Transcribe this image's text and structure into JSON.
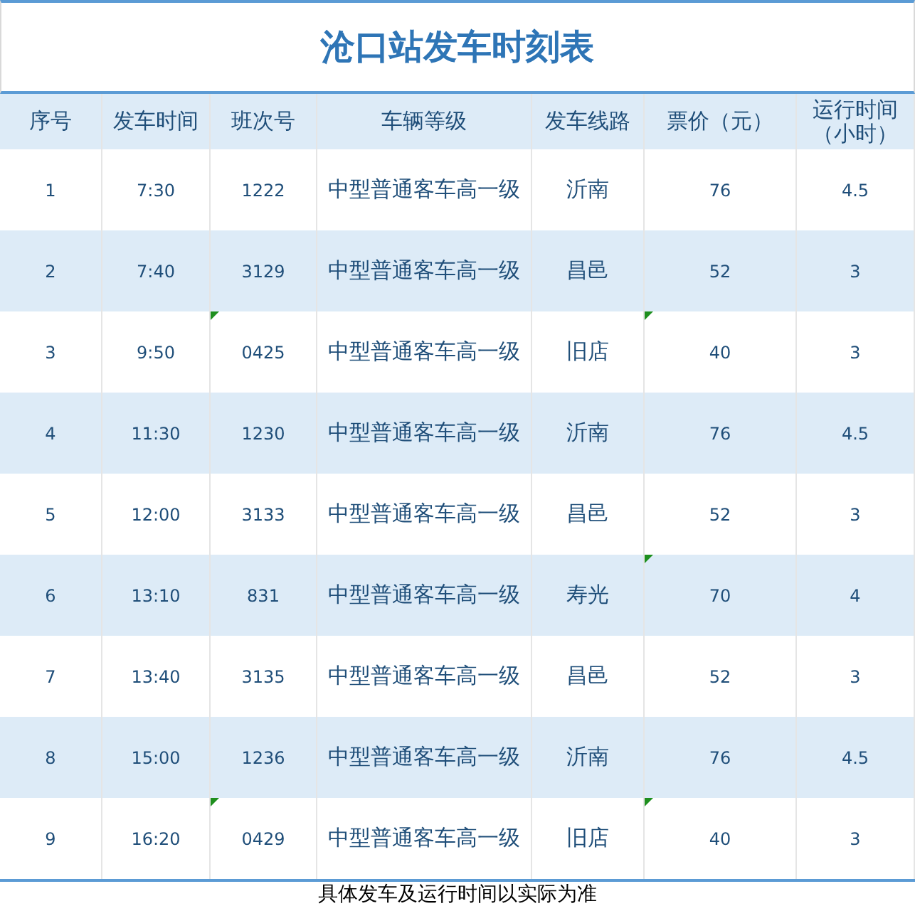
{
  "title": "沧口站发车时刻表",
  "columns": [
    "序号",
    "发车时间",
    "班次号",
    "车辆等级",
    "发车线路",
    "票价（元）",
    "运行时间（小时）"
  ],
  "rows": [
    {
      "cells": [
        {
          "text": "1",
          "flagged": false
        },
        {
          "text": "7:30",
          "flagged": false
        },
        {
          "text": "1222",
          "flagged": false
        },
        {
          "text": "中型普通客车高一级",
          "flagged": false
        },
        {
          "text": "沂南",
          "flagged": false
        },
        {
          "text": "76",
          "flagged": false
        },
        {
          "text": "4.5",
          "flagged": false
        }
      ]
    },
    {
      "cells": [
        {
          "text": "2",
          "flagged": false
        },
        {
          "text": "7:40",
          "flagged": false
        },
        {
          "text": "3129",
          "flagged": false
        },
        {
          "text": "中型普通客车高一级",
          "flagged": false
        },
        {
          "text": "昌邑",
          "flagged": false
        },
        {
          "text": "52",
          "flagged": false
        },
        {
          "text": "3",
          "flagged": false
        }
      ]
    },
    {
      "cells": [
        {
          "text": "3",
          "flagged": false
        },
        {
          "text": "9:50",
          "flagged": false
        },
        {
          "text": "0425",
          "flagged": true
        },
        {
          "text": "中型普通客车高一级",
          "flagged": false
        },
        {
          "text": "旧店",
          "flagged": false
        },
        {
          "text": "40",
          "flagged": true
        },
        {
          "text": "3",
          "flagged": false
        }
      ]
    },
    {
      "cells": [
        {
          "text": "4",
          "flagged": false
        },
        {
          "text": "11:30",
          "flagged": false
        },
        {
          "text": "1230",
          "flagged": false
        },
        {
          "text": "中型普通客车高一级",
          "flagged": false
        },
        {
          "text": "沂南",
          "flagged": false
        },
        {
          "text": "76",
          "flagged": false
        },
        {
          "text": "4.5",
          "flagged": false
        }
      ]
    },
    {
      "cells": [
        {
          "text": "5",
          "flagged": false
        },
        {
          "text": "12:00",
          "flagged": false
        },
        {
          "text": "3133",
          "flagged": false
        },
        {
          "text": "中型普通客车高一级",
          "flagged": false
        },
        {
          "text": "昌邑",
          "flagged": false
        },
        {
          "text": "52",
          "flagged": false
        },
        {
          "text": "3",
          "flagged": false
        }
      ]
    },
    {
      "cells": [
        {
          "text": "6",
          "flagged": false
        },
        {
          "text": "13:10",
          "flagged": false
        },
        {
          "text": "831",
          "flagged": false
        },
        {
          "text": "中型普通客车高一级",
          "flagged": false
        },
        {
          "text": "寿光",
          "flagged": false
        },
        {
          "text": "70",
          "flagged": true
        },
        {
          "text": "4",
          "flagged": false
        }
      ]
    },
    {
      "cells": [
        {
          "text": "7",
          "flagged": false
        },
        {
          "text": "13:40",
          "flagged": false
        },
        {
          "text": "3135",
          "flagged": false
        },
        {
          "text": "中型普通客车高一级",
          "flagged": false
        },
        {
          "text": "昌邑",
          "flagged": false
        },
        {
          "text": "52",
          "flagged": false
        },
        {
          "text": "3",
          "flagged": false
        }
      ]
    },
    {
      "cells": [
        {
          "text": "8",
          "flagged": false
        },
        {
          "text": "15:00",
          "flagged": false
        },
        {
          "text": "1236",
          "flagged": false
        },
        {
          "text": "中型普通客车高一级",
          "flagged": false
        },
        {
          "text": "沂南",
          "flagged": false
        },
        {
          "text": "76",
          "flagged": false
        },
        {
          "text": "4.5",
          "flagged": false
        }
      ]
    },
    {
      "cells": [
        {
          "text": "9",
          "flagged": false
        },
        {
          "text": "16:20",
          "flagged": false
        },
        {
          "text": "0429",
          "flagged": true
        },
        {
          "text": "中型普通客车高一级",
          "flagged": false
        },
        {
          "text": "旧店",
          "flagged": false
        },
        {
          "text": "40",
          "flagged": true
        },
        {
          "text": "3",
          "flagged": false
        }
      ]
    }
  ],
  "footer": "具体发车及运行时间以实际为准"
}
